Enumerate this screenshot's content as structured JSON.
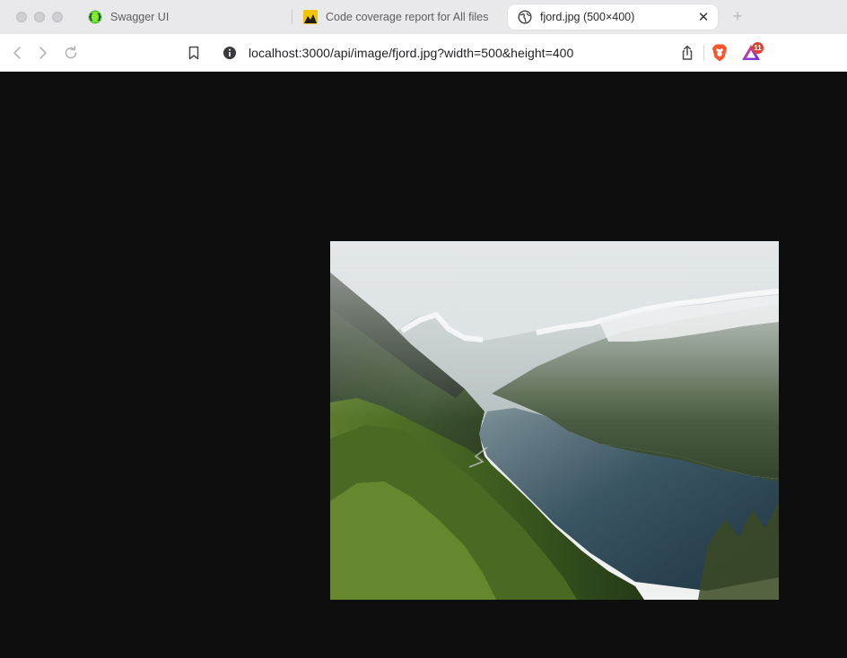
{
  "browser": {
    "tabs": [
      {
        "title": "Swagger UI",
        "icon": "swagger-icon",
        "active": false
      },
      {
        "title": "Code coverage report for All files",
        "icon": "coverage-icon",
        "active": false
      },
      {
        "title": "fjord.jpg (500×400)",
        "icon": "globe-icon",
        "active": true
      }
    ],
    "close_icon": "close-icon",
    "new_tab_icon": "plus-icon",
    "url": "localhost:3000/api/image/fjord.jpg?width=500&height=400",
    "toolbar_icons": [
      "back-icon",
      "forward-icon",
      "reload-icon",
      "bookmark-icon",
      "info-icon",
      "share-icon",
      "brave-shields-icon",
      "brave-rewards-icon"
    ],
    "rewards_badge": "11"
  },
  "viewer": {
    "image_name": "fjord.jpg",
    "image_description_icon": "fjord-photo",
    "background_color": "#0e0e0e"
  }
}
